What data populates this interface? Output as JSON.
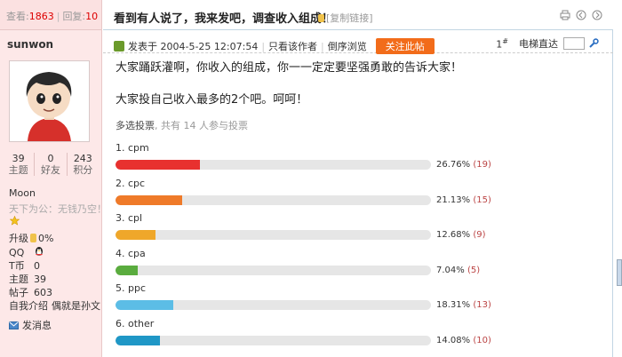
{
  "topbar": {
    "views_label": "查看:",
    "views": "1863",
    "replies_label": "回复:",
    "replies": "10"
  },
  "title": "看到有人说了，我来发吧，调查收入组成！",
  "copy_link": "[复制链接]",
  "author": {
    "name": "sunwon",
    "stats": [
      {
        "value": "39",
        "label": "主题"
      },
      {
        "value": "0",
        "label": "好友"
      },
      {
        "value": "243",
        "label": "积分"
      }
    ],
    "group": "Moon",
    "signature": "天下为公：无钱乃空！",
    "level_label": "升级",
    "level_value": "0%",
    "fields": [
      {
        "k": "QQ",
        "v": ""
      },
      {
        "k": "T币",
        "v": "0"
      },
      {
        "k": "主题",
        "v": "39"
      },
      {
        "k": "帖子",
        "v": "603"
      },
      {
        "k": "自我介绍",
        "v": "偶就是孙文"
      }
    ],
    "send_message": "发消息"
  },
  "meta": {
    "posted": "发表于 2004-5-25 12:07:54",
    "only_author": "只看该作者",
    "reverse": "倒序浏览",
    "follow": "关注此帖",
    "floor": "1",
    "floor_sup": "#",
    "jump_label": "电梯直达"
  },
  "post": {
    "line1": "大家踊跃灌啊，你收入的组成，你一一定定要坚强勇敢的告诉大家！",
    "line2": "大家投自己收入最多的2个吧。呵呵！"
  },
  "poll_info": {
    "type": "多选投票",
    "participants": ", 共有 14 人参与投票"
  },
  "chart_data": {
    "type": "bar",
    "categories": [
      "cpm",
      "cpc",
      "cpl",
      "cpa",
      "ppc",
      "other"
    ],
    "series": [
      {
        "values": [
          26.76,
          21.13,
          12.68,
          7.04,
          18.31,
          14.08
        ]
      }
    ],
    "counts": [
      19,
      15,
      9,
      5,
      13,
      10
    ],
    "labels": [
      "1. cpm",
      "2. cpc",
      "3. cpl",
      "4. cpa",
      "5. ppc",
      "6. other"
    ],
    "percent_text": [
      "26.76%",
      "21.13%",
      "12.68%",
      "7.04%",
      "18.31%",
      "14.08%"
    ],
    "count_text": [
      "(19)",
      "(15)",
      "(9)",
      "(5)",
      "(13)",
      "(10)"
    ],
    "colors": [
      "#e8312f",
      "#ef7a29",
      "#efa72a",
      "#5aac3e",
      "#5cbde6",
      "#1f97c6"
    ],
    "xlim": [
      0,
      100
    ]
  }
}
